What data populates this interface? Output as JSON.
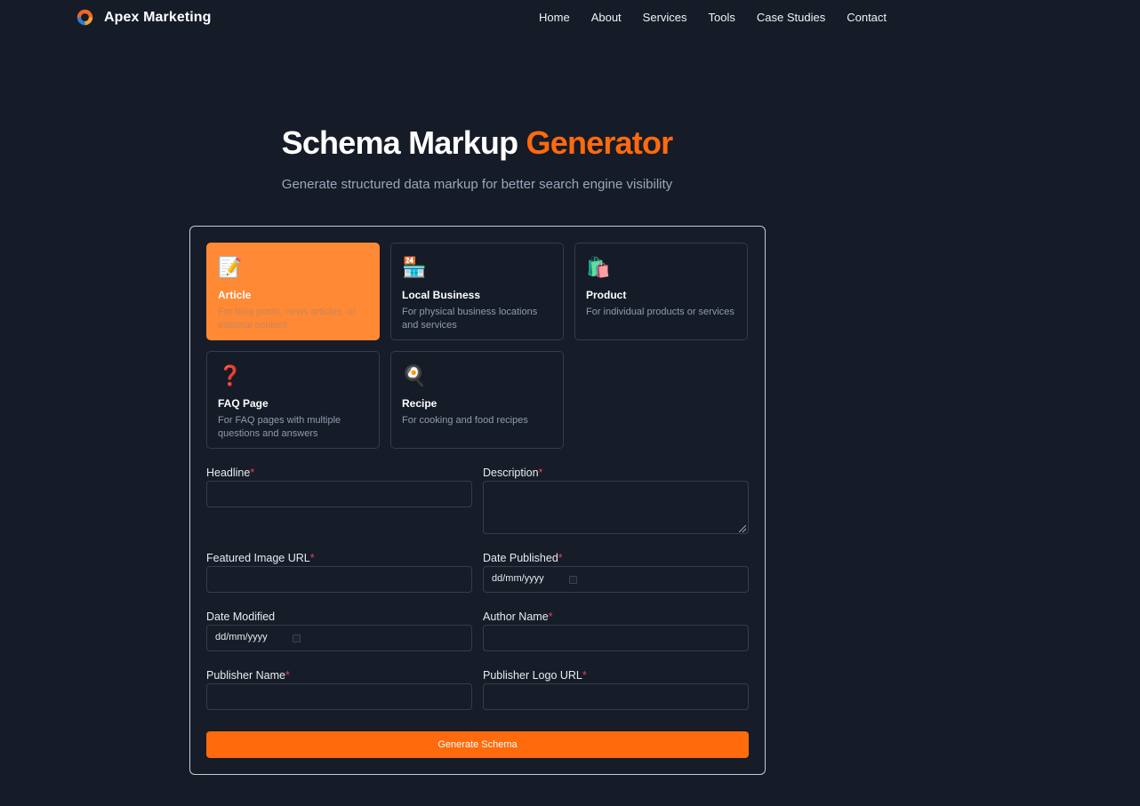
{
  "brand": {
    "name": "Apex Marketing",
    "logo_icon": "swirl-logo-icon"
  },
  "nav": {
    "links": [
      "Home",
      "About",
      "Services",
      "Tools",
      "Case Studies",
      "Contact"
    ]
  },
  "hero": {
    "title_main": "Schema Markup",
    "title_accent": "Generator",
    "subtitle": "Generate structured data markup for better search engine visibility"
  },
  "colors": {
    "accent": "#ff6a0d",
    "selected_card": "#ff8934",
    "background": "#151b27",
    "required": "#e0435a"
  },
  "schema_types": [
    {
      "icon": "📝",
      "icon_name": "memo-icon",
      "title": "Article",
      "desc": "For blog posts, news articles, or editorial content",
      "selected": true
    },
    {
      "icon": "🏪",
      "icon_name": "convenience-store-icon",
      "title": "Local Business",
      "desc": "For physical business locations and services",
      "selected": false
    },
    {
      "icon": "🛍️",
      "icon_name": "shopping-bags-icon",
      "title": "Product",
      "desc": "For individual products or services",
      "selected": false
    },
    {
      "icon": "❓",
      "icon_name": "question-mark-icon",
      "title": "FAQ Page",
      "desc": "For FAQ pages with multiple questions and answers",
      "selected": false
    },
    {
      "icon": "🍳",
      "icon_name": "frying-pan-icon",
      "title": "Recipe",
      "desc": "For cooking and food recipes",
      "selected": false
    }
  ],
  "form": {
    "headline": {
      "label": "Headline",
      "required": "*",
      "value": ""
    },
    "description": {
      "label": "Description",
      "required": "*",
      "value": ""
    },
    "featured_image": {
      "label": "Featured Image URL",
      "required": "*",
      "value": ""
    },
    "date_published": {
      "label": "Date Published",
      "required": "*",
      "placeholder": "dd/mm/yyyy"
    },
    "date_modified": {
      "label": "Date Modified",
      "placeholder": "dd/mm/yyyy"
    },
    "author_name": {
      "label": "Author Name",
      "required": "*",
      "value": ""
    },
    "publisher_name": {
      "label": "Publisher Name",
      "required": "*",
      "value": ""
    },
    "publisher_logo": {
      "label": "Publisher Logo URL",
      "required": "*",
      "value": ""
    },
    "submit_label": "Generate Schema"
  }
}
